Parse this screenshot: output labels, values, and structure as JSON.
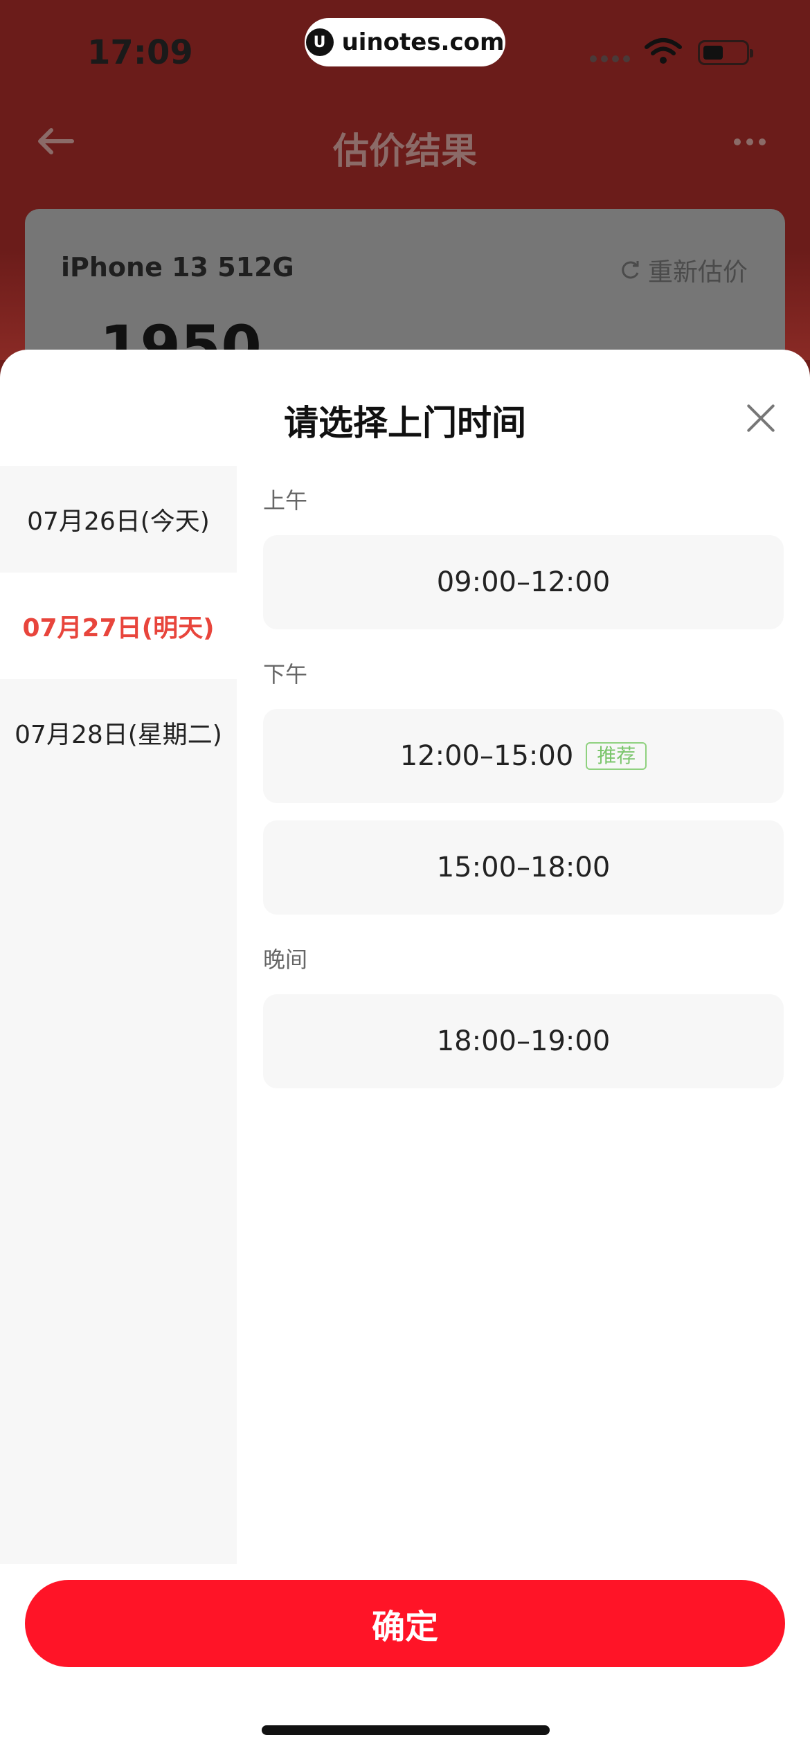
{
  "status_bar": {
    "time": "17:09"
  },
  "watermark": {
    "text": "uinotes.com"
  },
  "background_page": {
    "title": "估价结果",
    "card": {
      "model": "iPhone 13 512G",
      "reestimate_label": "重新估价",
      "price_partial": "1950"
    }
  },
  "sheet": {
    "title": "请选择上门时间",
    "dates": [
      {
        "label": "07月26日(今天)",
        "selected": false
      },
      {
        "label": "07月27日(明天)",
        "selected": true
      },
      {
        "label": "07月28日(星期二)",
        "selected": false
      }
    ],
    "sections": [
      {
        "label": "上午",
        "slots": [
          {
            "time": "09:00–12:00"
          }
        ]
      },
      {
        "label": "下午",
        "slots": [
          {
            "time": "12:00–15:00",
            "tag": "推荐"
          },
          {
            "time": "15:00–18:00"
          }
        ]
      },
      {
        "label": "晚间",
        "slots": [
          {
            "time": "18:00–19:00"
          }
        ]
      }
    ],
    "confirm_label": "确定"
  },
  "colors": {
    "accent": "#ff1427",
    "selected_date": "#e8453c",
    "tag_green": "#7ac56b"
  }
}
